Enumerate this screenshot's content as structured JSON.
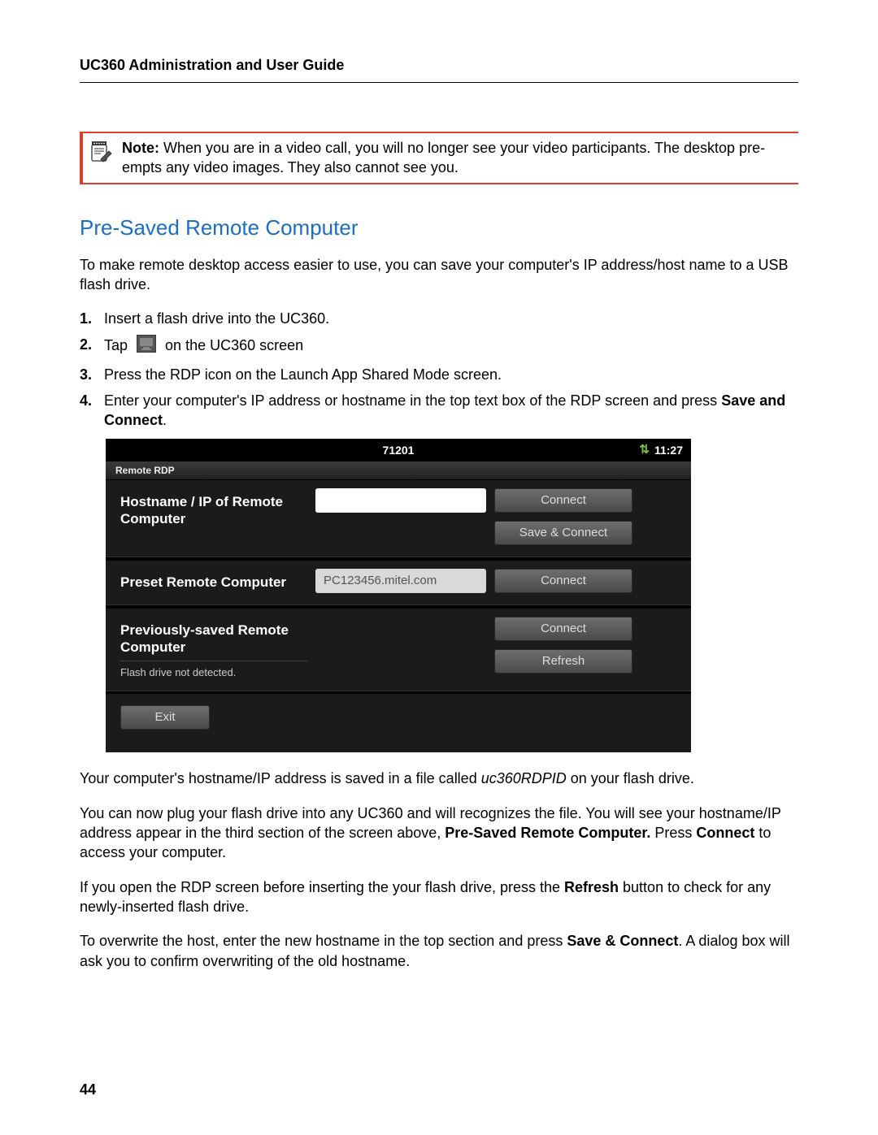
{
  "header": {
    "title": "UC360 Administration and User Guide"
  },
  "note": {
    "prefix": "Note:",
    "text": " When you are in a video call, you will no longer see your video participants. The desktop pre-empts any video images. They also cannot see you."
  },
  "section": {
    "title": "Pre-Saved Remote Computer"
  },
  "intro": "To make remote desktop access easier to use, you can save your computer's IP address/host name to a USB flash drive.",
  "steps": {
    "s1": "Insert a flash drive into the UC360.",
    "s2_before": "Tap ",
    "s2_after": " on the UC360 screen",
    "s3": "Press the RDP icon on the Launch App Shared Mode screen.",
    "s4_a": "Enter your computer's IP address or hostname in the top text box of the RDP screen and press ",
    "s4_b": "Save and Connect",
    "s4_c": "."
  },
  "screenshot": {
    "status": {
      "title": "71201",
      "time": "11:27"
    },
    "tab": "Remote RDP",
    "sec1": {
      "label": "Hostname / IP of Remote Computer",
      "btn_connect": "Connect",
      "btn_save": "Save & Connect"
    },
    "sec2": {
      "label": "Preset Remote Computer",
      "value": "PC123456.mitel.com",
      "btn_connect": "Connect"
    },
    "sec3": {
      "label": "Previously-saved Remote Computer",
      "sublabel": "Flash drive not detected.",
      "btn_connect": "Connect",
      "btn_refresh": "Refresh"
    },
    "exit": "Exit"
  },
  "para_a1": "Your computer's hostname/IP address is saved in a file called ",
  "para_a2": "uc360RDPID",
  "para_a3": " on your flash drive.",
  "para_b1": "You can now plug your flash drive into any UC360 and will recognizes the file. You will see your hostname/IP address appear in the third section of the screen above, ",
  "para_b2": "Pre-Saved Remote Computer.",
  "para_b3": " Press ",
  "para_b4": "Connect",
  "para_b5": " to access your computer.",
  "para_c1": "If you open the RDP screen before inserting the your flash drive, press the ",
  "para_c2": "Refresh",
  "para_c3": " button to check for any newly-inserted flash drive.",
  "para_d1": "To overwrite the host, enter the new hostname in the top section and press ",
  "para_d2": "Save & Connect",
  "para_d3": ". A dialog box will ask you to confirm overwriting of the old hostname.",
  "page_number": "44"
}
